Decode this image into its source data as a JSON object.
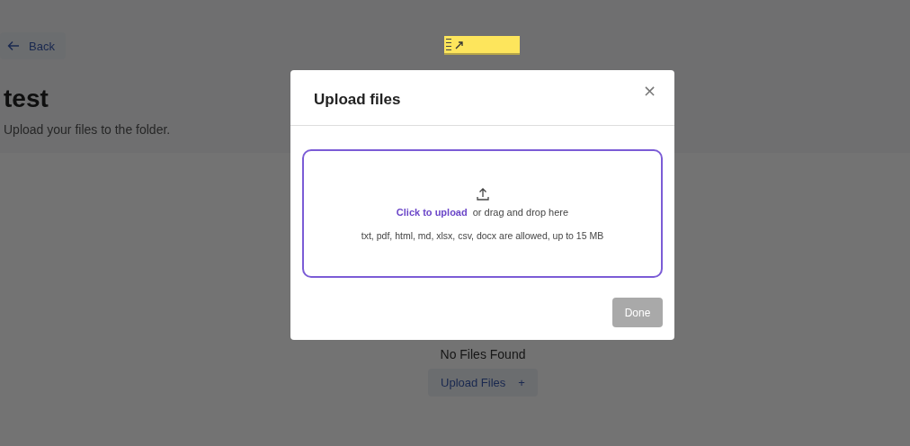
{
  "page": {
    "back": "Back",
    "title": "test",
    "subtitle": "Upload your files to the folder.",
    "empty_state": "No Files Found",
    "upload_button": "Upload Files",
    "upload_button_icon": "+"
  },
  "modal": {
    "title": "Upload files",
    "close": "×",
    "dropzone": {
      "link": "Click to upload",
      "text": "or drag and drop here",
      "hint": "txt, pdf, html, md, xlsx, csv, docx are allowed, up to 15 MB"
    },
    "done_button": {
      "label": "Done",
      "disabled": true
    }
  }
}
